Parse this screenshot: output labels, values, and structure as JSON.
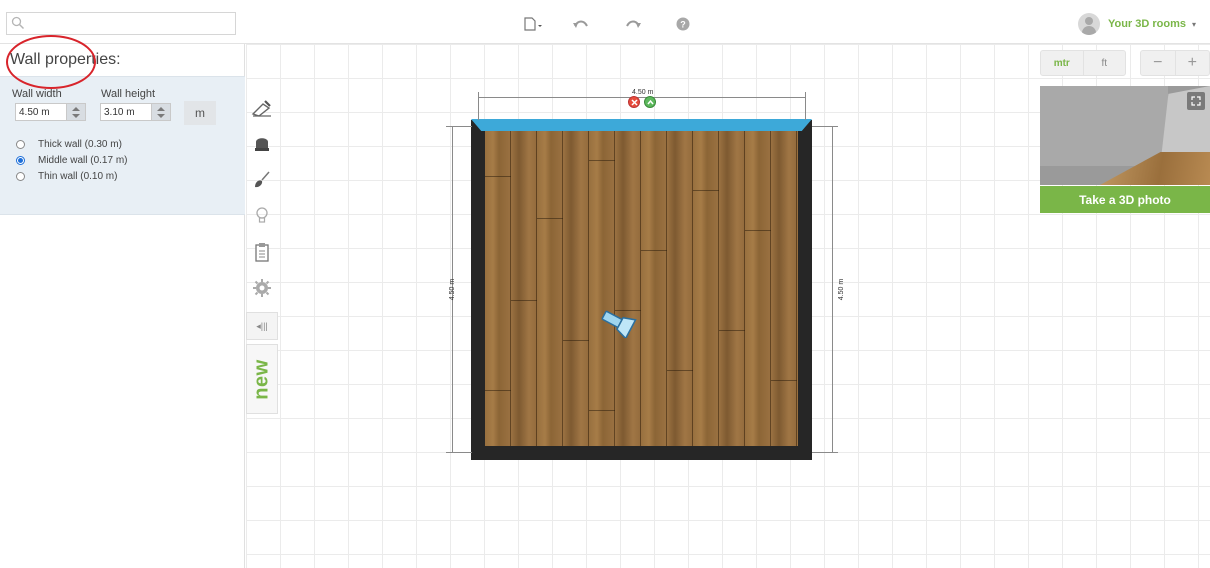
{
  "search": {
    "placeholder": "",
    "value": ""
  },
  "toolbar": {
    "new_icon": "new-document-icon",
    "undo_icon": "undo-icon",
    "redo_icon": "redo-icon",
    "help_icon": "help-icon"
  },
  "user": {
    "label": "Your 3D rooms",
    "caret": "▾"
  },
  "panel": {
    "title": "Wall properties:",
    "wall_width_label": "Wall width",
    "wall_width_value": "4.50 m",
    "wall_height_label": "Wall height",
    "wall_height_value": "3.10 m",
    "unit": "m",
    "options": [
      {
        "label": "Thick wall (0.30 m)",
        "checked": false
      },
      {
        "label": "Middle wall (0.17 m)",
        "checked": true
      },
      {
        "label": "Thin wall (0.10 m)",
        "checked": false
      }
    ]
  },
  "tools": {
    "items": [
      "wall-draw-icon",
      "furniture-icon",
      "paint-brush-icon",
      "lightbulb-icon",
      "clipboard-icon",
      "settings-icon"
    ],
    "collapse": "◂|||",
    "new_label": "new"
  },
  "plan": {
    "top_dimension": "4.50 m",
    "left_dimension": "4.50 m",
    "right_dimension": "4.50 m"
  },
  "right": {
    "unit_mtr": "mtr",
    "unit_ft": "ft",
    "zoom_out": "−",
    "zoom_in": "+",
    "photo_button": "Take a 3D photo"
  },
  "colors": {
    "accent_green": "#7ab648",
    "selected_wall": "#3da9d9",
    "highlight_circle": "#d8242b"
  }
}
